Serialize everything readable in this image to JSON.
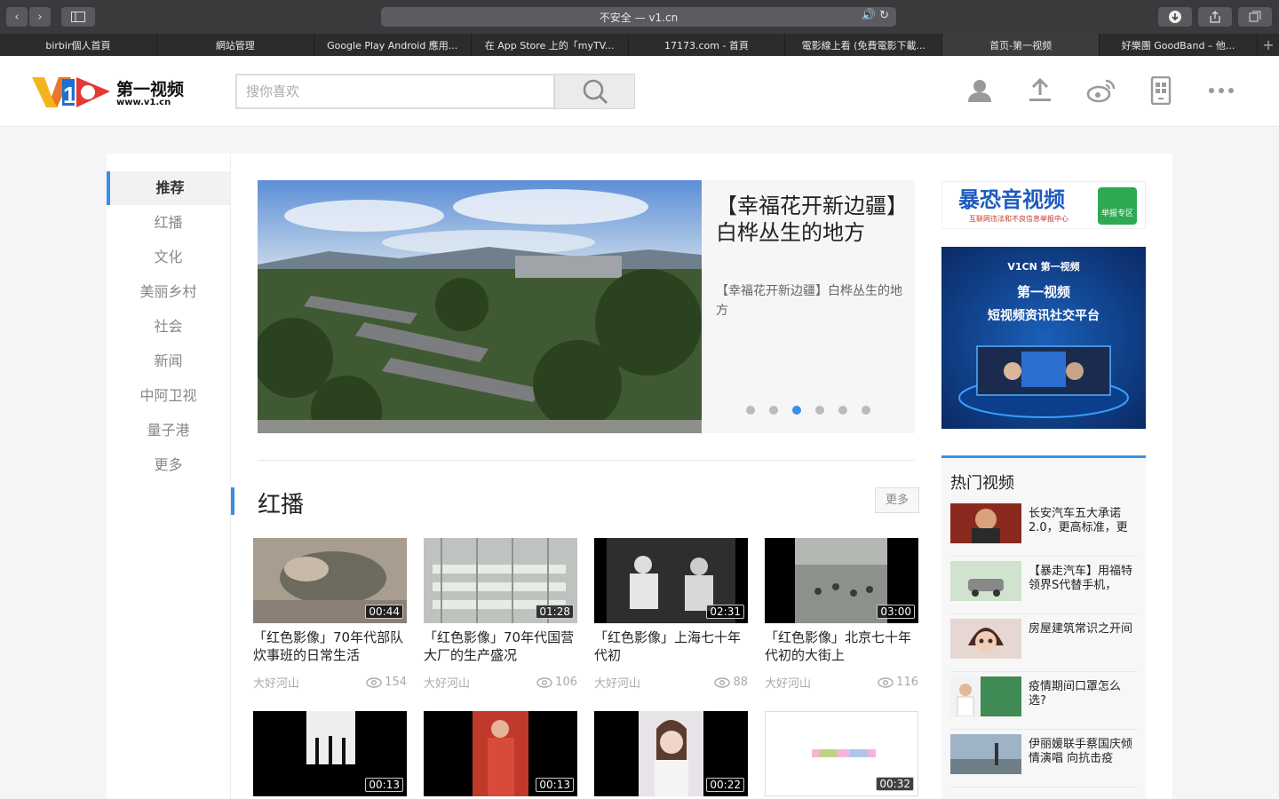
{
  "browser": {
    "address": "不安全 — v1.cn",
    "tabs": [
      "birbir個人首頁",
      "網站管理",
      "Google Play Android 應用...",
      "在 App Store 上的「myTV...",
      "17173.com - 首頁",
      "電影線上看 (免費電影下載...",
      "首页-第一视频",
      "好樂團 GoodBand – 他..."
    ]
  },
  "header": {
    "logo_text": "第一视频",
    "logo_sub": "www.v1.cn",
    "search_placeholder": "搜你喜欢"
  },
  "nav": [
    "推荐",
    "红播",
    "文化",
    "美丽乡村",
    "社会",
    "新闻",
    "中阿卫视",
    "量子港",
    "更多"
  ],
  "banner": {
    "title": "【幸福花开新边疆】白桦丛生的地方",
    "subtitle": "【幸福花开新边疆】白桦丛生的地方"
  },
  "section": {
    "title": "红播",
    "more": "更多"
  },
  "videos": [
    {
      "duration": "00:44",
      "title": "「红色影像」70年代部队炊事班的日常生活",
      "author": "大好河山",
      "views": "154"
    },
    {
      "duration": "01:28",
      "title": "「红色影像」70年代国营大厂的生产盛况",
      "author": "大好河山",
      "views": "106"
    },
    {
      "duration": "02:31",
      "title": "「红色影像」上海七十年代初",
      "author": "大好河山",
      "views": "88"
    },
    {
      "duration": "03:00",
      "title": "「红色影像」北京七十年代初的大街上",
      "author": "大好河山",
      "views": "116"
    },
    {
      "duration": "00:13",
      "title": "",
      "author": "",
      "views": ""
    },
    {
      "duration": "00:13",
      "title": "",
      "author": "",
      "views": ""
    },
    {
      "duration": "00:22",
      "title": "",
      "author": "",
      "views": ""
    },
    {
      "duration": "00:32",
      "title": "",
      "author": "",
      "views": ""
    }
  ],
  "hot": {
    "title": "热门视频",
    "items": [
      "长安汽车五大承诺2.0，更高标准，更",
      "【暴走汽车】用福特领界S代替手机，",
      "房屋建筑常识之开间",
      "疫情期间口罩怎么选?",
      "伊丽媛联手蔡国庆倾情演唱 向抗击疫"
    ]
  },
  "ads": {
    "ad1_main": "暴恐音视频",
    "ad1_sub": "互联网违法和不良信息举报中心",
    "ad1_badge": "举报专区",
    "ad2_logo": "V1CN 第一视频",
    "ad2_line1": "第一视频",
    "ad2_line2": "短视频资讯社交平台"
  }
}
